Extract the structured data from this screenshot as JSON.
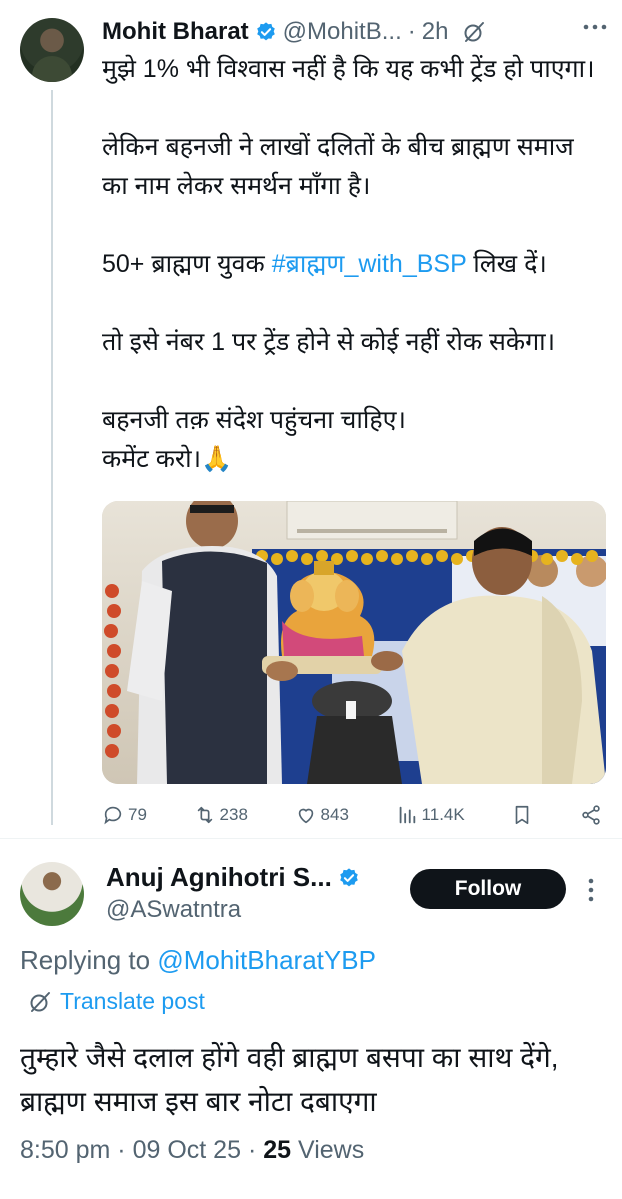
{
  "tweet": {
    "author_name": "Mohit Bharat",
    "author_handle": "@MohitB...",
    "time_ago": "2h",
    "body_lines": [
      "मुझे 1% भी विश्वास नहीं है कि यह कभी ट्रेंड हो पाएगा।",
      "",
      "लेकिन बहनजी ने लाखों दलितों के बीच ब्राह्मण समाज का नाम लेकर समर्थन माँगा है।",
      "",
      "50+ ब्राह्मण युवक ",
      "",
      "तो इसे नंबर 1 पर ट्रेंड होने से कोई नहीं रोक सकेगा।",
      "",
      "बहनजी तक़ संदेश पहुंचना चाहिए।",
      "कमेंट करो।🙏"
    ],
    "hashtag_line": {
      "prefix": "50+ ब्राह्मण युवक ",
      "hashtag": "#ब्राह्मण_with_BSP",
      "suffix": " लिख दें।"
    },
    "image_icon": "photo-of-two-people-holding-ganesha-idol",
    "stats": {
      "replies": "79",
      "reposts": "238",
      "likes": "843",
      "views": "11.4K"
    }
  },
  "reply": {
    "author_name": "Anuj Agnihotri S...",
    "author_handle": "@ASwatntra",
    "follow_label": "Follow",
    "replying_prefix": "Replying to ",
    "replying_to": "@MohitBharatYBP",
    "translate_label": "Translate post",
    "body": "तुम्हारे जैसे दलाल होंगे वही ब्राह्मण बसपा का साथ देंगे, ब्राह्मण समाज इस बार नोटा दबाएगा",
    "time": "8:50 pm",
    "date": "09 Oct 25",
    "views_count": "25",
    "views_label": " Views"
  },
  "colors": {
    "accent": "#1d9bf0",
    "text": "#0f1419",
    "muted": "#536471"
  }
}
